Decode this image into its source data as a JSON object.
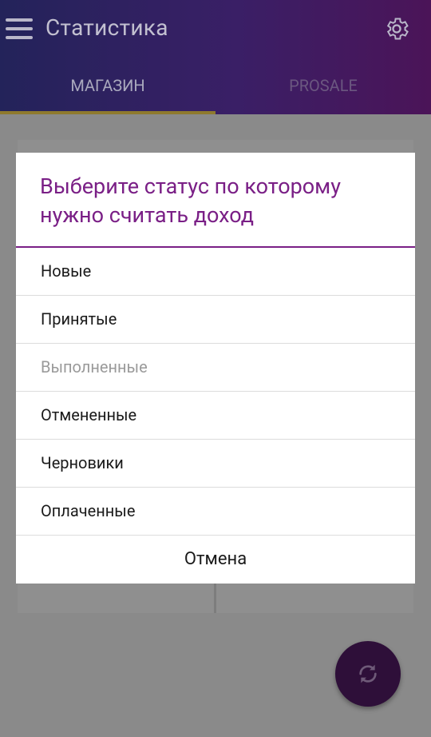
{
  "app_bar": {
    "title": "Статистика",
    "menu_icon": "hamburger-menu-icon",
    "settings_icon": "gear-icon",
    "colors": {
      "gradient_start": "#23235a",
      "gradient_end": "#4b1458"
    }
  },
  "tabs": [
    {
      "label": "МАГАЗИН",
      "active": true
    },
    {
      "label": "PROSALE",
      "active": false
    }
  ],
  "dialog": {
    "title": "Выберите статус по которому нужно считать доход",
    "options": [
      {
        "label": "Новые",
        "enabled": true
      },
      {
        "label": "Принятые",
        "enabled": true
      },
      {
        "label": "Выполненные",
        "enabled": false
      },
      {
        "label": "Отмененные",
        "enabled": true
      },
      {
        "label": "Черновики",
        "enabled": true
      },
      {
        "label": "Оплаченные",
        "enabled": true
      }
    ],
    "cancel_label": "Отмена",
    "accent_color": "#7a1f86"
  },
  "fab": {
    "icon": "refresh-icon",
    "color": "#2e0f39"
  }
}
